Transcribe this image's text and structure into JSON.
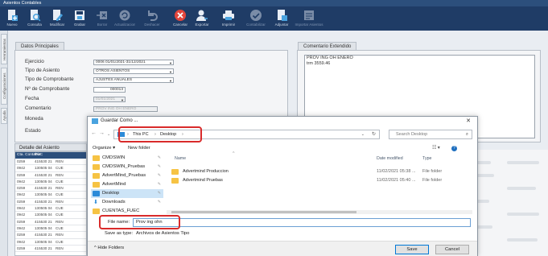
{
  "window": {
    "title": "Asientos Contables"
  },
  "toolbar": {
    "items": [
      {
        "label": "Nuevo",
        "icon": "new-doc-icon"
      },
      {
        "label": "Consulta",
        "icon": "query-icon"
      },
      {
        "label": "Modificar",
        "icon": "edit-icon"
      },
      {
        "label": "Grabar",
        "icon": "save-icon"
      },
      {
        "label": "Borrar",
        "icon": "erase-icon"
      },
      {
        "label": "Actualizaciones",
        "icon": "update-icon"
      },
      {
        "label": "Deshacer",
        "icon": "undo-icon"
      },
      {
        "label": "Cancelar",
        "icon": "cancel-icon"
      },
      {
        "label": "Exportar",
        "icon": "export-icon"
      },
      {
        "label": "Imprimir",
        "icon": "print-icon"
      },
      {
        "label": "Contabilizar",
        "icon": "check-icon"
      },
      {
        "label": "Adjuntar",
        "icon": "attach-icon"
      },
      {
        "label": "Importar Asientos",
        "icon": "import-icon"
      }
    ]
  },
  "side_tabs": [
    "Herramientas",
    "Configuraciones",
    "Ayuda"
  ],
  "datos": {
    "title": "Datos Principales",
    "fields": [
      {
        "label": "Ejercicio",
        "value": "0006 01/01/2021-31/12/2021"
      },
      {
        "label": "Tipo de Asiento",
        "value": "OTROS ASIENTOS"
      },
      {
        "label": "Tipo de Comprobante",
        "value": "AJUSTES ANUALES"
      },
      {
        "label": "Nº de Comprobante",
        "value": "000013"
      },
      {
        "label": "Fecha",
        "value": "01/01/2021"
      },
      {
        "label": "Comentario",
        "value": "PROV ING OH ENERO"
      },
      {
        "label": "Moneda",
        "value": ""
      },
      {
        "label": "Estado",
        "value": ""
      }
    ]
  },
  "comentario": {
    "title": "Comentario Extendido",
    "lines": [
      "PROV ING OH ENERO",
      "trm 3559.46"
    ]
  },
  "detalle": {
    "title": "Detalle del Asiento",
    "headers": [
      "Cta. Contable",
      "PUC",
      ""
    ],
    "rows": [
      [
        "0259",
        "415530 21",
        "REN"
      ],
      [
        "0942",
        "130505 04",
        "CUE"
      ],
      [
        "0259",
        "415530 21",
        "REN"
      ],
      [
        "0942",
        "130505 04",
        "CUE"
      ],
      [
        "0259",
        "415530 21",
        "REN"
      ],
      [
        "0942",
        "130505 04",
        "CUE"
      ],
      [
        "0259",
        "415530 21",
        "REN"
      ],
      [
        "0942",
        "130505 04",
        "CUE"
      ],
      [
        "0942",
        "130505 04",
        "CUE"
      ],
      [
        "0259",
        "415530 21",
        "REN"
      ],
      [
        "0942",
        "130505 04",
        "CUE"
      ],
      [
        "0259",
        "415530 21",
        "REN"
      ],
      [
        "0942",
        "130505 04",
        "CUE"
      ],
      [
        "0259",
        "415530 21",
        "REN"
      ]
    ]
  },
  "dialog": {
    "title": "Guardar Como ...",
    "path": [
      "This PC",
      "Desktop"
    ],
    "search_placeholder": "Search Desktop",
    "organize_label": "Organize ▾",
    "new_folder_label": "New folder",
    "nav_items": [
      {
        "label": "CMDSWIN",
        "pinned": true
      },
      {
        "label": "CMDSWIN_Pruebas",
        "pinned": true
      },
      {
        "label": "AdvertMind_Pruebas",
        "pinned": true
      },
      {
        "label": "AdvertMind",
        "pinned": true
      },
      {
        "label": "Desktop",
        "pinned": true
      },
      {
        "label": "Downloads",
        "pinned": true
      },
      {
        "label": "CUENTAS_FUEC",
        "pinned": false
      }
    ],
    "columns": [
      "Name",
      "Date modified",
      "Type"
    ],
    "files": [
      {
        "name": "Advertmind Produccion",
        "date": "11/02/2021 05:38 ...",
        "type": "File folder"
      },
      {
        "name": "Advertmind Pruebas",
        "date": "11/02/2021 05:40 ...",
        "type": "File folder"
      }
    ],
    "file_name_label": "File name:",
    "file_name_value": "Prov ing ohn",
    "save_type_label": "Save as type:",
    "save_type_value": "Archivos de Asientos Tipo",
    "hide_folders_label": "Hide Folders",
    "save_label": "Save",
    "cancel_label": "Cancel",
    "colors": {
      "highlight": "#d92b2b",
      "accent": "#0078d7"
    }
  }
}
